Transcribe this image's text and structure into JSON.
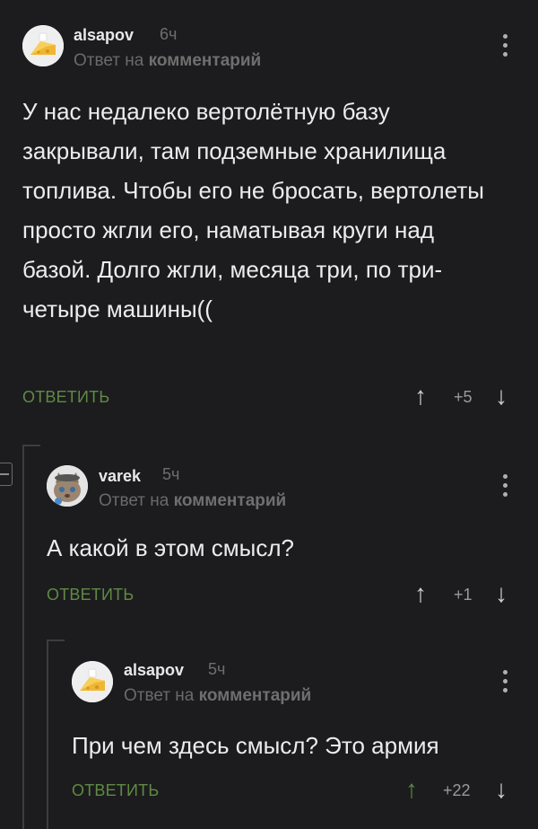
{
  "comments": [
    {
      "username": "alsapov",
      "time": "6ч",
      "reply_prefix": "Ответ на",
      "reply_target": "комментарий",
      "text": "У нас недалеко вертолётную базу закрывали, там подземные хранилища топлива. Чтобы его не бросать, вертолеты просто жгли его, наматывая круги над базой. Долго жгли, месяца три, по три-четыре машины((",
      "reply_label": "ОТВЕТИТЬ",
      "score": "+5",
      "avatar": "cheese-avatar"
    },
    {
      "username": "varek",
      "time": "5ч",
      "reply_prefix": "Ответ на",
      "reply_target": "комментарий",
      "text": "А какой в этом смысл?",
      "reply_label": "ОТВЕТИТЬ",
      "score": "+1",
      "avatar": "cat-avatar"
    },
    {
      "username": "alsapov",
      "time": "5ч",
      "reply_prefix": "Ответ на",
      "reply_target": "комментарий",
      "text": "При чем здесь смысл? Это армия",
      "reply_label": "ОТВЕТИТЬ",
      "score": "+22",
      "upvoted": true,
      "avatar": "cheese-avatar"
    }
  ],
  "colors": {
    "background": "#1c1c1e",
    "reply_button": "#5f8a45",
    "upvote_active": "#5f8a45",
    "arrow_default": "#cfcfcf",
    "thread_line": "#3d3d40"
  },
  "icons": {
    "upvote": "arrow-up-icon",
    "downvote": "arrow-down-icon",
    "menu": "more-vertical-icon",
    "collapse": "collapse-thread-icon"
  }
}
